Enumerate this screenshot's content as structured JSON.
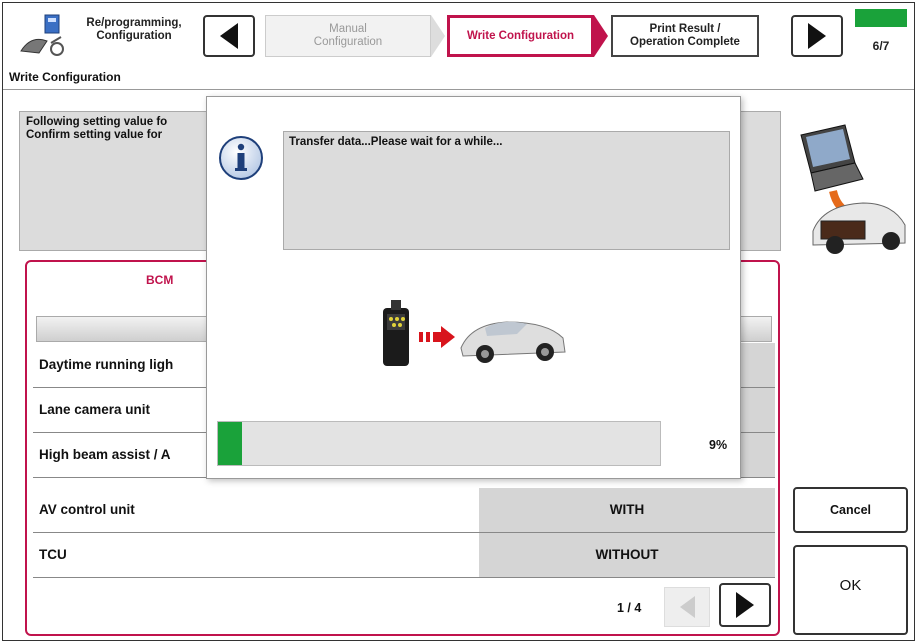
{
  "header": {
    "app_title": "Re/programming,\nConfiguration",
    "steps": [
      {
        "label": "Manual\nConfiguration",
        "state": "inactive"
      },
      {
        "label": "Write Configuration",
        "state": "active"
      },
      {
        "label": "Print Result /\nOperation Complete",
        "state": "next"
      }
    ],
    "step_count": "6/7",
    "section_title": "Write Configuration"
  },
  "main": {
    "message_lines": "Following setting value fo\nConfirm setting value for",
    "bcm_tab": "BCM",
    "rows": [
      {
        "label": "Daytime running ligh",
        "value": ""
      },
      {
        "label": "Lane camera unit",
        "value": ""
      },
      {
        "label": "High beam assist / A",
        "value": ""
      },
      {
        "label": "AV control unit",
        "value": "WITH"
      },
      {
        "label": "TCU",
        "value": "WITHOUT"
      }
    ],
    "page_indicator": "1 / 4"
  },
  "buttons": {
    "cancel": "Cancel",
    "ok": "OK"
  },
  "modal": {
    "message": "Transfer data...Please wait for a while...",
    "progress_percent": 9,
    "progress_text": "9%"
  },
  "colors": {
    "accent": "#c0134c",
    "progress": "#1aa23a",
    "panel_gray": "#dcdcdc"
  },
  "icons": {
    "app": "programming-icon",
    "info": "info-icon",
    "transfer": "consult-to-car-icon",
    "side": "laptop-to-car-icon"
  }
}
